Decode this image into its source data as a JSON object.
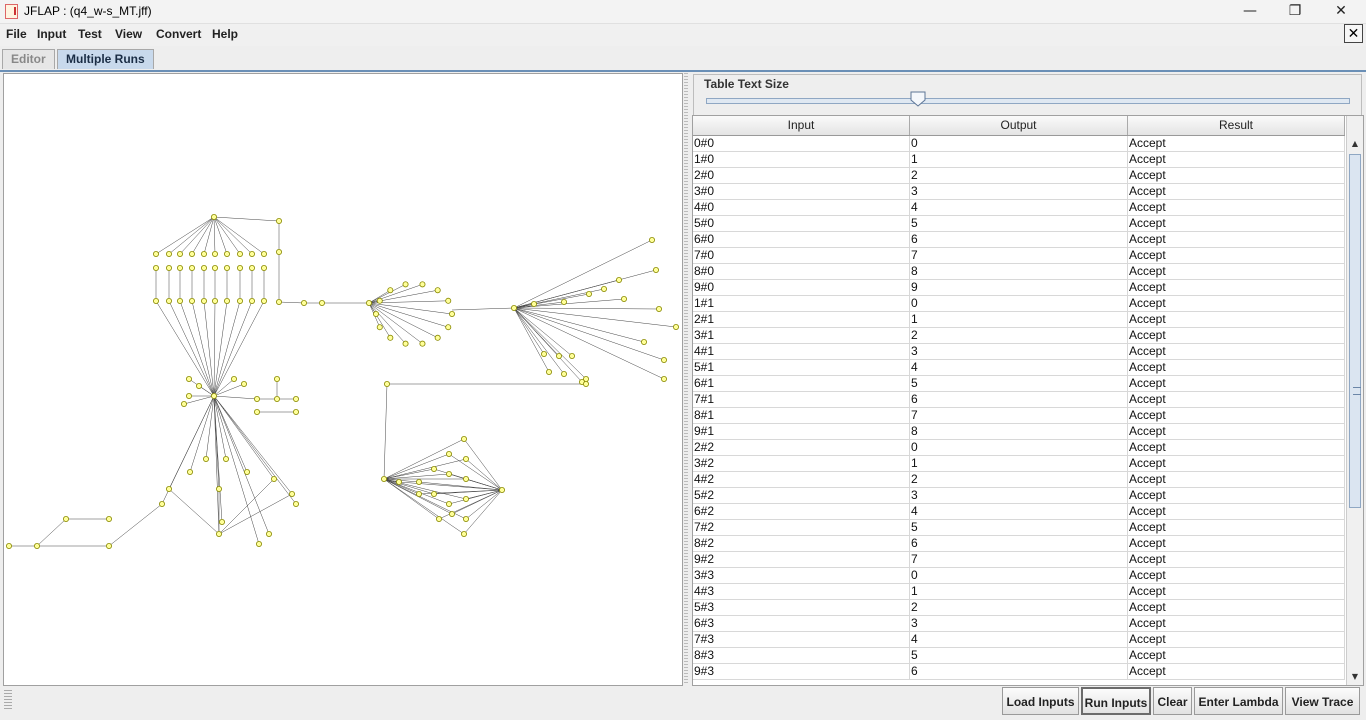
{
  "window": {
    "title": "JFLAP : (q4_w-s_MT.jff)",
    "minimize_glyph": "—",
    "maximize_glyph": "❐",
    "close_glyph": "✕"
  },
  "menu": [
    "File",
    "Input",
    "Test",
    "View",
    "Convert",
    "Help"
  ],
  "close_tab_glyph": "✕",
  "tabs": [
    {
      "label": "Editor",
      "active": false
    },
    {
      "label": "Multiple Runs",
      "active": true
    }
  ],
  "table_text_size": {
    "label": "Table Text Size",
    "slider_level": 0.33
  },
  "table": {
    "columns": [
      "Input",
      "Output",
      "Result"
    ],
    "rows": [
      [
        "0#0",
        "0",
        "Accept"
      ],
      [
        "1#0",
        "1",
        "Accept"
      ],
      [
        "2#0",
        "2",
        "Accept"
      ],
      [
        "3#0",
        "3",
        "Accept"
      ],
      [
        "4#0",
        "4",
        "Accept"
      ],
      [
        "5#0",
        "5",
        "Accept"
      ],
      [
        "6#0",
        "6",
        "Accept"
      ],
      [
        "7#0",
        "7",
        "Accept"
      ],
      [
        "8#0",
        "8",
        "Accept"
      ],
      [
        "9#0",
        "9",
        "Accept"
      ],
      [
        "1#1",
        "0",
        "Accept"
      ],
      [
        "2#1",
        "1",
        "Accept"
      ],
      [
        "3#1",
        "2",
        "Accept"
      ],
      [
        "4#1",
        "3",
        "Accept"
      ],
      [
        "5#1",
        "4",
        "Accept"
      ],
      [
        "6#1",
        "5",
        "Accept"
      ],
      [
        "7#1",
        "6",
        "Accept"
      ],
      [
        "8#1",
        "7",
        "Accept"
      ],
      [
        "9#1",
        "8",
        "Accept"
      ],
      [
        "2#2",
        "0",
        "Accept"
      ],
      [
        "3#2",
        "1",
        "Accept"
      ],
      [
        "4#2",
        "2",
        "Accept"
      ],
      [
        "5#2",
        "3",
        "Accept"
      ],
      [
        "6#2",
        "4",
        "Accept"
      ],
      [
        "7#2",
        "5",
        "Accept"
      ],
      [
        "8#2",
        "6",
        "Accept"
      ],
      [
        "9#2",
        "7",
        "Accept"
      ],
      [
        "3#3",
        "0",
        "Accept"
      ],
      [
        "4#3",
        "1",
        "Accept"
      ],
      [
        "5#3",
        "2",
        "Accept"
      ],
      [
        "6#3",
        "3",
        "Accept"
      ],
      [
        "7#3",
        "4",
        "Accept"
      ],
      [
        "8#3",
        "5",
        "Accept"
      ],
      [
        "9#3",
        "6",
        "Accept"
      ]
    ]
  },
  "buttons": {
    "load_inputs": "Load Inputs",
    "run_inputs": "Run Inputs",
    "clear": "Clear",
    "enter_lambda": "Enter Lambda",
    "view_trace": "View Trace"
  },
  "colors": {
    "state_fill": "#ffff99",
    "state_stroke": "#888800",
    "tab_active": "#c8d9ec",
    "edge": "#444444"
  }
}
